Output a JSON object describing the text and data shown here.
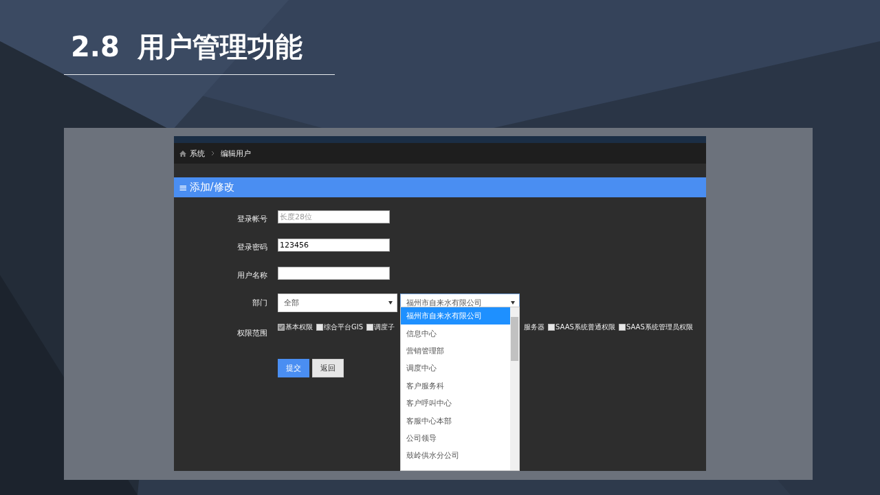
{
  "slide": {
    "number": "2.8",
    "title": "用户管理功能"
  },
  "breadcrumb": {
    "items": [
      "系统",
      "编辑用户"
    ]
  },
  "panel": {
    "icon": "≡",
    "title": "添加/修改"
  },
  "form": {
    "fields": [
      {
        "label": "登录帐号",
        "placeholder": "长度28位"
      },
      {
        "label": "登录密码",
        "value": "123456"
      },
      {
        "label": "用户名称"
      }
    ],
    "department": {
      "label": "部门",
      "select_1": {
        "value": "全部"
      },
      "select_2": {
        "value": "福州市自来水有限公司",
        "expanded": true,
        "options": [
          {
            "label": "福州市自来水有限公司",
            "selected": true
          },
          {
            "label": "信息中心",
            "selected": false
          },
          {
            "label": "营销管理部",
            "selected": false
          },
          {
            "label": "调度中心",
            "selected": false
          },
          {
            "label": "客户服务科",
            "selected": false
          },
          {
            "label": "客户呼叫中心",
            "selected": false
          },
          {
            "label": "客服中心本部",
            "selected": false
          },
          {
            "label": "公司领导",
            "selected": false
          },
          {
            "label": "鼓岭供水分公司",
            "selected": false
          }
        ]
      }
    },
    "permissions": {
      "label": "权限范围",
      "items": [
        {
          "kind": "checkbox",
          "label": "基本权限",
          "checked": true
        },
        {
          "kind": "checkbox",
          "label": "综合平台GIS",
          "checked": false
        },
        {
          "kind": "checkbox",
          "label": "调度子",
          "checked": false
        },
        {
          "kind": "text",
          "label": "服务器"
        },
        {
          "kind": "checkbox",
          "label": "SAAS系统普通权限",
          "checked": false
        },
        {
          "kind": "checkbox",
          "label": "SAAS系统管理员权限",
          "checked": false
        }
      ]
    },
    "buttons": [
      {
        "kind": "primary",
        "label": "提交"
      },
      {
        "kind": "default",
        "label": "返回"
      }
    ]
  }
}
